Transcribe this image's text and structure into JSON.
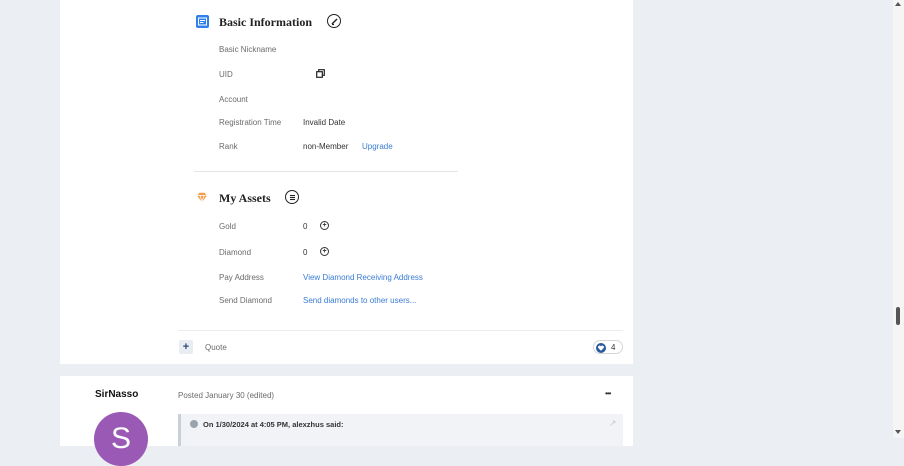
{
  "basic_info": {
    "title": "Basic Information",
    "rows": [
      {
        "label": "Basic Nickname",
        "value": ""
      },
      {
        "label": "UID",
        "value": ""
      },
      {
        "label": "Account",
        "value": ""
      },
      {
        "label": "Registration Time",
        "value": "Invalid Date"
      },
      {
        "label": "Rank",
        "value": "non-Member",
        "link": "Upgrade"
      }
    ]
  },
  "assets": {
    "title": "My Assets",
    "rows": [
      {
        "label": "Gold",
        "value": "0"
      },
      {
        "label": "Diamond",
        "value": "0"
      },
      {
        "label": "Pay Address",
        "link": "View Diamond Receiving Address"
      },
      {
        "label": "Send Diamond",
        "link": "Send diamonds to other users..."
      }
    ]
  },
  "post_footer": {
    "quote_label": "Quote",
    "reaction_count": "4"
  },
  "next_post": {
    "author": "SirNasso",
    "avatar_letter": "S",
    "posted": "Posted January 30 (edited)",
    "menu": "•••",
    "quote_header": "On 1/30/2024 at 4:05 PM, alexzhus said:"
  },
  "colors": {
    "accent": "#3a7bd5",
    "avatar": "#9b59b6",
    "background": "#ebeef2"
  }
}
